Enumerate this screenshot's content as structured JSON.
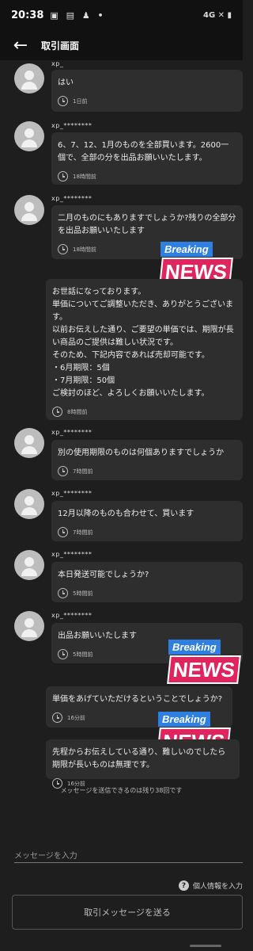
{
  "status_bar": {
    "time": "20:38",
    "icons": "▣ ▤ ♟ •",
    "right": "4G ✕ ▮"
  },
  "app_bar": {
    "title": "取引画面"
  },
  "messages": [
    {
      "sender": "xp_",
      "text": "はい",
      "time": "1日前"
    },
    {
      "sender": "xp_********",
      "text": "6、7、12、1月のものを全部買います。2600一個で、全部の分を出品お願いいたします。",
      "time": "18時間前"
    },
    {
      "sender": "xp_********",
      "text": "二月のものにもありますでしょうか?残りの全部分を出品お願いいたします",
      "time": "18時間前"
    },
    {
      "sender": "",
      "text": "お世話になっております。\n単価についてご調整いただき、ありがとうございます。\n以前お伝えした通り、ご要望の単価では、期限が長い商品のご提供は難しい状況です。\nそのため、下記内容であれば売却可能です。\n・6月期限：5個\n・7月期限：50個\nご検討のほど、よろしくお願いいたします。",
      "time": "8時間前"
    },
    {
      "sender": "xp_********",
      "text": "別の使用期限のものは何個ありますでしょうか",
      "time": "7時間前"
    },
    {
      "sender": "xp_********",
      "text": "12月以降のものも合わせて、買います",
      "time": "7時間前"
    },
    {
      "sender": "xp_********",
      "text": "本日発送可能でしょうか?",
      "time": "5時間前"
    },
    {
      "sender": "xp_********",
      "text": "出品お願いいたします",
      "time": "5時間前"
    },
    {
      "sender": "",
      "text": "単価をあげていただけるということでしょうか?",
      "time": "16分前"
    },
    {
      "sender": "",
      "text": "先程からお伝えしている通り、難しいのでしたら期限が長いものは無理です。",
      "time": "16分前"
    }
  ],
  "stickers": [
    {
      "line1": "Breaking",
      "line2": "NEWS"
    },
    {
      "line1": "Breaking",
      "line2": "NEWS"
    },
    {
      "line1": "Breaking",
      "line2": "NEWS"
    }
  ],
  "remaining_notice": "メッセージを送信できるのは残り38回です",
  "input": {
    "placeholder": "メッセージを入力"
  },
  "privacy": {
    "label": "個人情報を入力"
  },
  "send_button": {
    "label": "取引メッセージを送る"
  },
  "colors": {
    "background": "#1e1e1e",
    "bubble": "#2e2e2e",
    "breaking_blue": "#2f7fe0",
    "news_red": "#e0245e"
  }
}
